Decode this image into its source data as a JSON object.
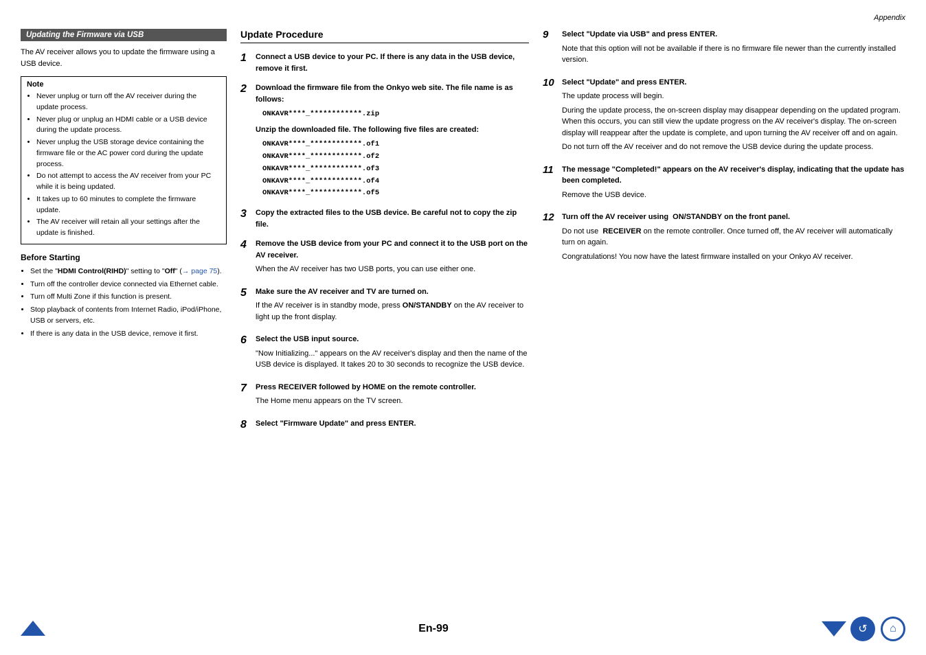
{
  "header": {
    "label": "Appendix"
  },
  "left_section": {
    "title": "Updating the Firmware via USB",
    "intro": "The AV receiver allows you to update the firmware using a USB device.",
    "note_label": "Note",
    "note_items": [
      "Never unplug or turn off the AV receiver during the update process.",
      "Never plug or unplug an HDMI cable or a USB device during the update process.",
      "Never unplug the USB storage device containing the firmware file or the AC power cord during the update process.",
      "Do not attempt to access the AV receiver from your PC while it is being updated.",
      "It takes up to 60 minutes to complete the firmware update.",
      "The AV receiver will retain all your settings after the update is finished."
    ],
    "before_starting_title": "Before Starting",
    "before_starting_items": [
      "Set the \"HDMI Control(RIHD)\" setting to \"Off\" (→ page 75).",
      "Turn off the controller device connected via Ethernet cable.",
      "Turn off Multi Zone if this function is present.",
      "Stop playback of contents from Internet Radio, iPod/iPhone, USB or servers, etc.",
      "If there is any data in the USB device, remove it first."
    ]
  },
  "mid_section": {
    "title": "Update Procedure",
    "steps": [
      {
        "num": "1",
        "bold_text": "Connect a USB device to your PC. If there is any data in the USB device, remove it first."
      },
      {
        "num": "2",
        "bold_text": "Download the firmware file from the Onkyo web site. The file name is as follows:",
        "file_name": "ONKAVR****_************.zip",
        "sub_bold": "Unzip the downloaded file. The following five files are created:",
        "file_list": [
          "ONKAVR****_************.of1",
          "ONKAVR****_************.of2",
          "ONKAVR****_************.of3",
          "ONKAVR****_************.of4",
          "ONKAVR****_************.of5"
        ]
      },
      {
        "num": "3",
        "bold_text": "Copy the extracted files to the USB device. Be careful not to copy the zip file."
      },
      {
        "num": "4",
        "bold_text": "Remove the USB device from your PC and connect it to the USB port on the AV receiver.",
        "normal_text": "When the AV receiver has two USB ports, you can use either one."
      },
      {
        "num": "5",
        "bold_text": "Make sure the AV receiver and TV are turned on.",
        "normal_text": "If the AV receiver is in standby mode, press ON/STANDBY on the AV receiver to light up the front display."
      },
      {
        "num": "6",
        "bold_text": "Select the USB input source.",
        "normal_text": "\"Now Initializing...\" appears on the AV receiver's display and then the name of the USB device is displayed. It takes 20 to 30 seconds to recognize the USB device."
      },
      {
        "num": "7",
        "bold_text": "Press RECEIVER followed by HOME on the remote controller.",
        "normal_text": "The Home menu appears on the TV screen."
      },
      {
        "num": "8",
        "bold_text": "Select \"Firmware Update\" and press ENTER."
      }
    ]
  },
  "right_section": {
    "steps": [
      {
        "num": "9",
        "bold_text": "Select \"Update via USB\" and press ENTER.",
        "normal_text": "Note that this option will not be available if there is no firmware file newer than the currently installed version."
      },
      {
        "num": "10",
        "bold_text": "Select \"Update\" and press ENTER.",
        "normal_text": "The update process will begin.",
        "extra_text": "During the update process, the on-screen display may disappear depending on the updated program. When this occurs, you can still view the update progress on the AV receiver's display. The on-screen display will reappear after the update is complete, and upon turning the AV receiver off and on again.",
        "extra_text2": "Do not turn off the AV receiver and do not remove the USB device during the update process."
      },
      {
        "num": "11",
        "bold_text": "The message \"Completed!\" appears on the AV receiver's display, indicating that the update has been completed.",
        "normal_text": "Remove the USB device."
      },
      {
        "num": "12",
        "bold_text": "Turn off the AV receiver using  ON/STANDBY on the front panel.",
        "normal_text": "Do not use  RECEIVER on the remote controller. Once turned off, the AV receiver will automatically turn on again.",
        "extra_text": "Congratulations! You now have the latest firmware installed on your Onkyo AV receiver."
      }
    ]
  },
  "footer": {
    "page_label": "En-99"
  }
}
